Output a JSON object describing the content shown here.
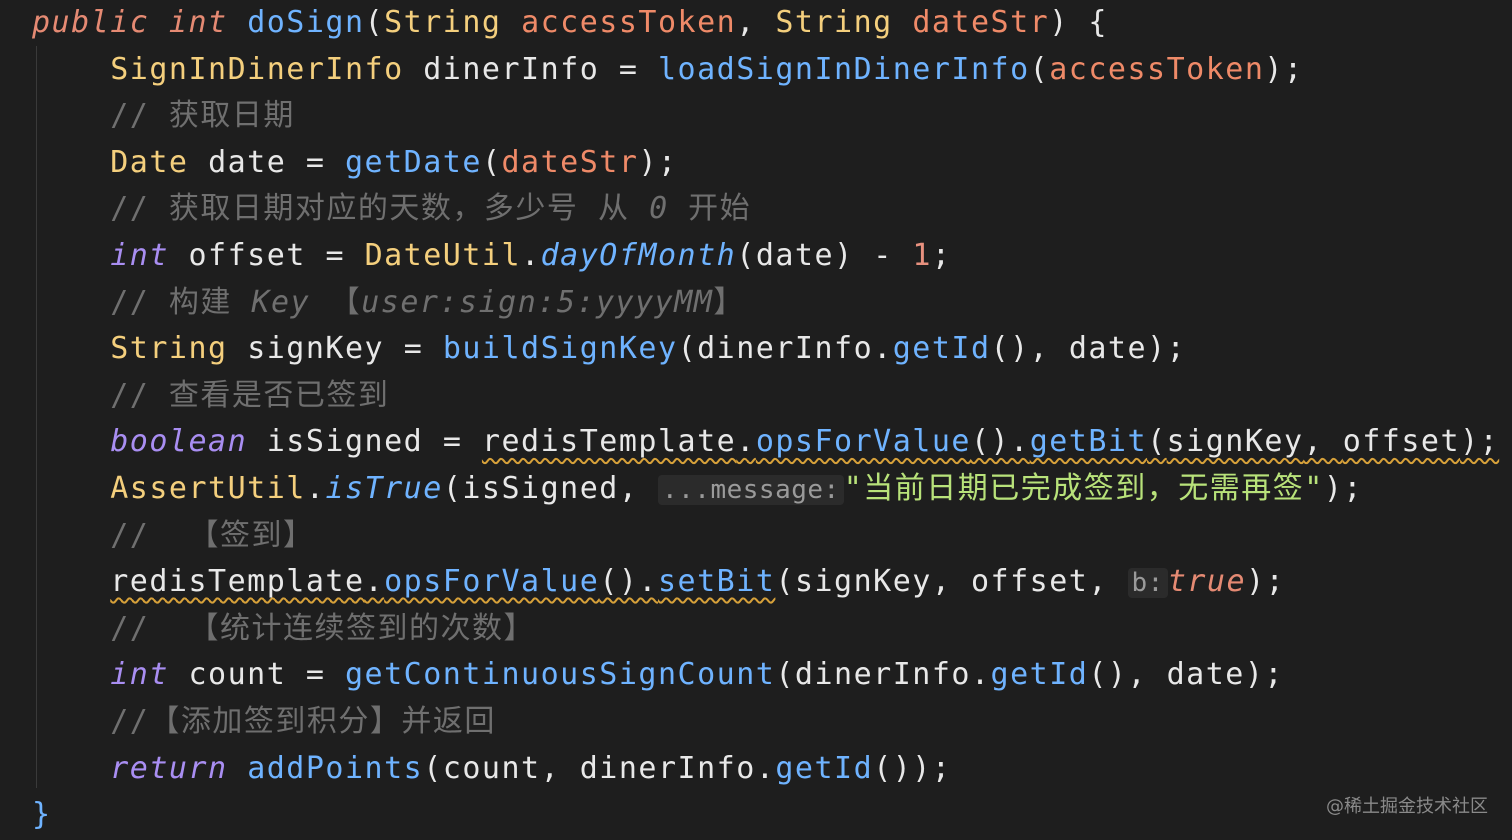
{
  "colors": {
    "background": "#1e1e1e",
    "keyword": "#e58a73",
    "type": "#f4cf7d",
    "parameter": "#ef8a68",
    "method": "#6fb3ff",
    "plain": "#e8e8e8",
    "comment": "#6f6f6f",
    "string": "#b8e27a",
    "number": "#e8917f",
    "purple": "#a98ef2",
    "warning": "#d7a13a"
  },
  "editor": {
    "lines": [
      {
        "name": "code-line-1",
        "tokens": [
          {
            "text": "public int ",
            "kind": "keyword",
            "italic": true
          },
          {
            "text": "doSign",
            "kind": "method"
          },
          {
            "text": "(",
            "kind": "plain"
          },
          {
            "text": "String ",
            "kind": "type"
          },
          {
            "text": "accessToken",
            "kind": "parameter"
          },
          {
            "text": ", ",
            "kind": "plain"
          },
          {
            "text": "String ",
            "kind": "type"
          },
          {
            "text": "dateStr",
            "kind": "parameter"
          },
          {
            "text": ") {",
            "kind": "plain"
          }
        ]
      },
      {
        "name": "code-line-2",
        "tokens": [
          {
            "text": "    ",
            "kind": "plain"
          },
          {
            "text": "SignInDinerInfo ",
            "kind": "type"
          },
          {
            "text": "dinerInfo ",
            "kind": "plain"
          },
          {
            "text": "= ",
            "kind": "plain"
          },
          {
            "text": "loadSignInDinerInfo",
            "kind": "method"
          },
          {
            "text": "(",
            "kind": "plain"
          },
          {
            "text": "accessToken",
            "kind": "parameter"
          },
          {
            "text": ");",
            "kind": "plain"
          }
        ]
      },
      {
        "name": "comment-line-3",
        "tokens": [
          {
            "text": "    // 获取日期",
            "kind": "comment"
          }
        ]
      },
      {
        "name": "code-line-4",
        "tokens": [
          {
            "text": "    ",
            "kind": "plain"
          },
          {
            "text": "Date ",
            "kind": "type"
          },
          {
            "text": "date ",
            "kind": "plain"
          },
          {
            "text": "= ",
            "kind": "plain"
          },
          {
            "text": "getDate",
            "kind": "method"
          },
          {
            "text": "(",
            "kind": "plain"
          },
          {
            "text": "dateStr",
            "kind": "parameter"
          },
          {
            "text": ");",
            "kind": "plain"
          }
        ]
      },
      {
        "name": "comment-line-5",
        "tokens": [
          {
            "text": "    // 获取日期对应的天数，多少号 从 ",
            "kind": "comment"
          },
          {
            "text": "0",
            "kind": "comment",
            "italic": true
          },
          {
            "text": " 开始",
            "kind": "comment"
          }
        ]
      },
      {
        "name": "code-line-6",
        "tokens": [
          {
            "text": "    ",
            "kind": "plain"
          },
          {
            "text": "int ",
            "kind": "purple",
            "italic": true
          },
          {
            "text": "offset ",
            "kind": "plain"
          },
          {
            "text": "= ",
            "kind": "plain"
          },
          {
            "text": "DateUtil",
            "kind": "type"
          },
          {
            "text": ".",
            "kind": "plain"
          },
          {
            "text": "dayOfMonth",
            "kind": "method",
            "italic": true
          },
          {
            "text": "(",
            "kind": "plain"
          },
          {
            "text": "date",
            "kind": "plain"
          },
          {
            "text": ") ",
            "kind": "plain"
          },
          {
            "text": "- ",
            "kind": "plain"
          },
          {
            "text": "1",
            "kind": "number"
          },
          {
            "text": ";",
            "kind": "plain"
          }
        ]
      },
      {
        "name": "comment-line-7",
        "tokens": [
          {
            "text": "    // 构建 ",
            "kind": "comment"
          },
          {
            "text": "Key ",
            "kind": "comment",
            "italic": true
          },
          {
            "text": "【",
            "kind": "comment"
          },
          {
            "text": "user:sign:5:yyyyMM",
            "kind": "comment",
            "italic": true
          },
          {
            "text": "】",
            "kind": "comment"
          }
        ]
      },
      {
        "name": "code-line-8",
        "tokens": [
          {
            "text": "    ",
            "kind": "plain"
          },
          {
            "text": "String ",
            "kind": "type"
          },
          {
            "text": "signKey ",
            "kind": "plain"
          },
          {
            "text": "= ",
            "kind": "plain"
          },
          {
            "text": "buildSignKey",
            "kind": "method"
          },
          {
            "text": "(",
            "kind": "plain"
          },
          {
            "text": "dinerInfo",
            "kind": "plain"
          },
          {
            "text": ".",
            "kind": "plain"
          },
          {
            "text": "getId",
            "kind": "method"
          },
          {
            "text": "(), ",
            "kind": "plain"
          },
          {
            "text": "date",
            "kind": "plain"
          },
          {
            "text": ");",
            "kind": "plain"
          }
        ]
      },
      {
        "name": "comment-line-9",
        "tokens": [
          {
            "text": "    // 查看是否已签到",
            "kind": "comment"
          }
        ]
      },
      {
        "name": "code-line-10",
        "tokens": [
          {
            "text": "    ",
            "kind": "plain"
          },
          {
            "text": "boolean ",
            "kind": "purple",
            "italic": true
          },
          {
            "text": "isSigned ",
            "kind": "plain"
          },
          {
            "text": "= ",
            "kind": "plain"
          },
          {
            "text": "redisTemplate",
            "kind": "plain",
            "squiggle": true
          },
          {
            "text": ".",
            "kind": "plain",
            "squiggle": true
          },
          {
            "text": "opsForValue",
            "kind": "method",
            "squiggle": true
          },
          {
            "text": "().",
            "kind": "plain",
            "squiggle": true
          },
          {
            "text": "getBit",
            "kind": "method",
            "squiggle": true
          },
          {
            "text": "(",
            "kind": "plain",
            "squiggle": true
          },
          {
            "text": "signKey",
            "kind": "plain",
            "squiggle": true
          },
          {
            "text": ", ",
            "kind": "plain",
            "squiggle": true
          },
          {
            "text": "offset",
            "kind": "plain",
            "squiggle": true
          },
          {
            "text": ");",
            "kind": "plain",
            "squiggle": true
          }
        ]
      },
      {
        "name": "code-line-11",
        "tokens": [
          {
            "text": "    ",
            "kind": "plain"
          },
          {
            "text": "AssertUtil",
            "kind": "type"
          },
          {
            "text": ".",
            "kind": "plain"
          },
          {
            "text": "isTrue",
            "kind": "method",
            "italic": true
          },
          {
            "text": "(",
            "kind": "plain"
          },
          {
            "text": "isSigned",
            "kind": "plain"
          },
          {
            "text": ", ",
            "kind": "plain"
          },
          {
            "text": "...message:",
            "kind": "hint"
          },
          {
            "text": "\"当前日期已完成签到，无需再签\"",
            "kind": "string"
          },
          {
            "text": ");",
            "kind": "plain"
          }
        ]
      },
      {
        "name": "comment-line-12",
        "tokens": [
          {
            "text": "    //  【签到】",
            "kind": "comment"
          }
        ]
      },
      {
        "name": "code-line-13",
        "tokens": [
          {
            "text": "    ",
            "kind": "plain"
          },
          {
            "text": "redisTemplate",
            "kind": "plain",
            "squiggle": true
          },
          {
            "text": ".",
            "kind": "plain",
            "squiggle": true
          },
          {
            "text": "opsForValue",
            "kind": "method",
            "squiggle": true
          },
          {
            "text": "().",
            "kind": "plain",
            "squiggle": true
          },
          {
            "text": "setBit",
            "kind": "method",
            "squiggle": true
          },
          {
            "text": "(",
            "kind": "plain"
          },
          {
            "text": "signKey",
            "kind": "plain"
          },
          {
            "text": ", ",
            "kind": "plain"
          },
          {
            "text": "offset",
            "kind": "plain"
          },
          {
            "text": ", ",
            "kind": "plain"
          },
          {
            "text": "b:",
            "kind": "hint"
          },
          {
            "text": "true",
            "kind": "keyword",
            "italic": true
          },
          {
            "text": ");",
            "kind": "plain"
          }
        ]
      },
      {
        "name": "comment-line-14",
        "tokens": [
          {
            "text": "    //  【统计连续签到的次数】",
            "kind": "comment"
          }
        ]
      },
      {
        "name": "code-line-15",
        "tokens": [
          {
            "text": "    ",
            "kind": "plain"
          },
          {
            "text": "int ",
            "kind": "purple",
            "italic": true
          },
          {
            "text": "count ",
            "kind": "plain"
          },
          {
            "text": "= ",
            "kind": "plain"
          },
          {
            "text": "getContinuousSignCount",
            "kind": "method"
          },
          {
            "text": "(",
            "kind": "plain"
          },
          {
            "text": "dinerInfo",
            "kind": "plain"
          },
          {
            "text": ".",
            "kind": "plain"
          },
          {
            "text": "getId",
            "kind": "method"
          },
          {
            "text": "(), ",
            "kind": "plain"
          },
          {
            "text": "date",
            "kind": "plain"
          },
          {
            "text": ");",
            "kind": "plain"
          }
        ]
      },
      {
        "name": "comment-line-16",
        "tokens": [
          {
            "text": "    //【添加签到积分】并返回",
            "kind": "comment"
          }
        ]
      },
      {
        "name": "code-line-17",
        "tokens": [
          {
            "text": "    ",
            "kind": "plain"
          },
          {
            "text": "return ",
            "kind": "purple",
            "italic": true
          },
          {
            "text": "addPoints",
            "kind": "method"
          },
          {
            "text": "(",
            "kind": "plain"
          },
          {
            "text": "count",
            "kind": "plain"
          },
          {
            "text": ", ",
            "kind": "plain"
          },
          {
            "text": "dinerInfo",
            "kind": "plain"
          },
          {
            "text": ".",
            "kind": "plain"
          },
          {
            "text": "getId",
            "kind": "method"
          },
          {
            "text": "());",
            "kind": "plain"
          }
        ]
      },
      {
        "name": "code-line-18",
        "tokens": [
          {
            "text": "}",
            "kind": "method"
          }
        ]
      }
    ]
  },
  "watermark": {
    "text": "@稀土掘金技术社区"
  }
}
